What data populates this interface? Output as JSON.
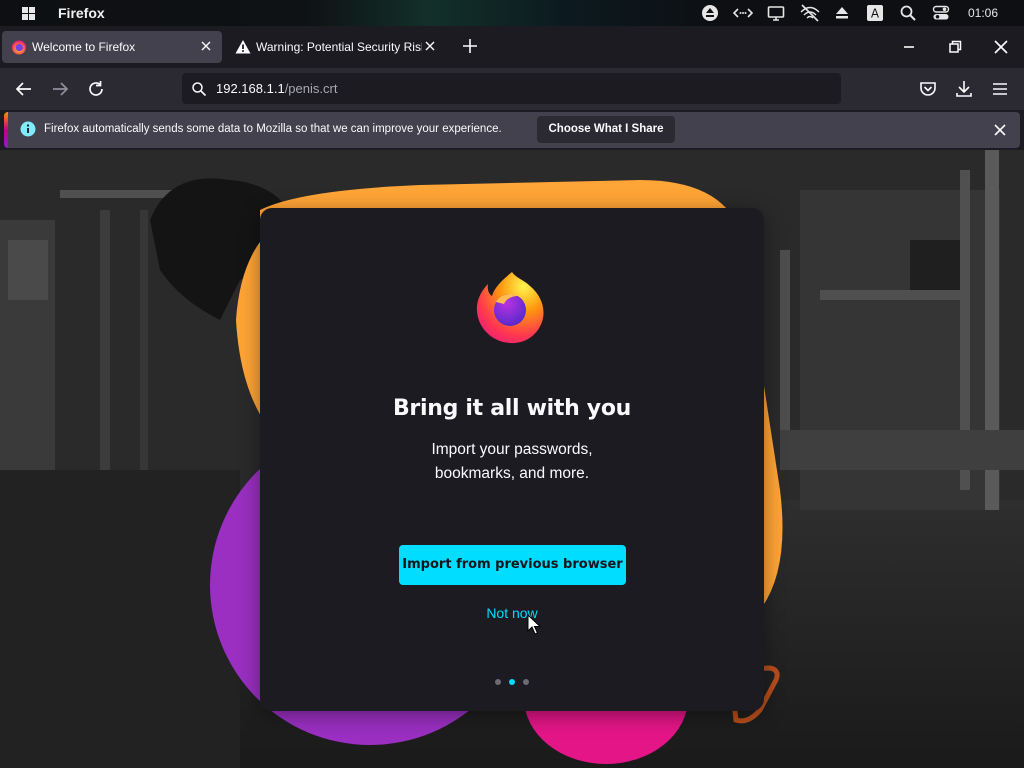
{
  "os_bar": {
    "app_name": "Firefox",
    "clock": "01:06"
  },
  "tabs": [
    {
      "label": "Welcome to Firefox",
      "icon": "firefox-icon",
      "active": true
    },
    {
      "label": "Warning: Potential Security Risk Ahead",
      "icon": "warning-icon",
      "active": false
    }
  ],
  "nav": {
    "url_host": "192.168.1.1",
    "url_path": "/penis.crt"
  },
  "notification": {
    "text": "Firefox automatically sends some data to Mozilla so that we can improve your experience.",
    "button_label": "Choose What I Share"
  },
  "onboarding": {
    "title": "Bring it all with you",
    "subtitle_line1": "Import your passwords,",
    "subtitle_line2": "bookmarks, and more.",
    "primary_button": "Import from previous browser",
    "secondary_link": "Not now",
    "steps_total": 3,
    "step_active": 2
  },
  "colors": {
    "accent": "#00ddff",
    "shape_orange": "#ffa436",
    "shape_purple": "#9a2fc1",
    "shape_pink": "#e31587"
  }
}
